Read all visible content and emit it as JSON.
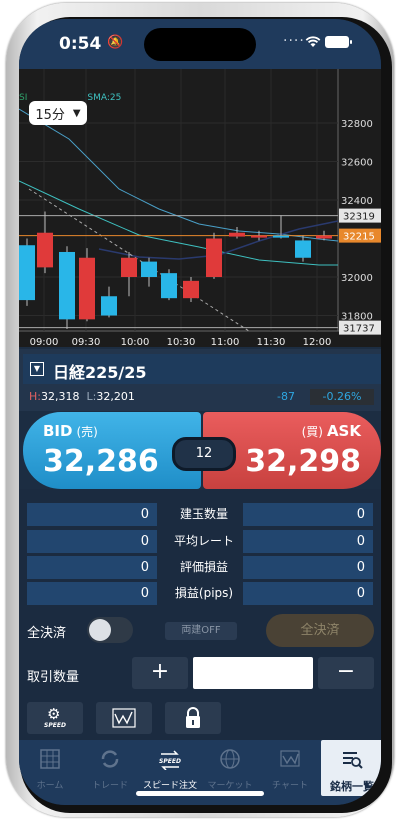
{
  "status": {
    "time": "0:54"
  },
  "chart": {
    "timeframe": "15分",
    "sma_label": "SMA:25",
    "y_ticks": [
      "32800",
      "32600",
      "32400",
      "32000",
      "31800"
    ],
    "x_ticks": [
      "09:00",
      "09:30",
      "10:00",
      "10:30",
      "11:00",
      "11:30",
      "12:00"
    ],
    "markers": {
      "high": "32319",
      "current": "32215",
      "low": "31737"
    },
    "colors": {
      "up": "#e03a3a",
      "down": "#29b6e8",
      "current": "#e8882c",
      "sma": "#3ec0c0"
    }
  },
  "symbol": {
    "name": "日経225/25",
    "high_label": "H:",
    "high": "32,318",
    "low_label": "L:",
    "low": "32,201",
    "change": "-87",
    "change_pct": "-0.26%"
  },
  "bid": {
    "label": "BID",
    "sub": "(売)",
    "value": "32,286"
  },
  "ask": {
    "label": "ASK",
    "sub": "(買)",
    "value": "32,298"
  },
  "spread": "12",
  "position": {
    "rows": [
      {
        "label": "建玉数量",
        "left": "0",
        "right": "0"
      },
      {
        "label": "平均レート",
        "left": "0",
        "right": "0"
      },
      {
        "label": "評価損益",
        "left": "0",
        "right": "0"
      },
      {
        "label": "損益(pips)",
        "left": "0",
        "right": "0"
      }
    ]
  },
  "controls": {
    "close_all_label": "全決済",
    "hedge_off": "両建OFF",
    "close_all_button": "全決済",
    "quantity_label": "取引数量",
    "plus": "+",
    "minus": "−",
    "speed_icon_text": "SPEED"
  },
  "tabs": [
    {
      "label": "ホーム",
      "icon": "home-icon"
    },
    {
      "label": "トレード",
      "icon": "trade-icon"
    },
    {
      "label": "スピード注文",
      "icon": "speed-order-icon"
    },
    {
      "label": "マーケット",
      "icon": "globe-icon"
    },
    {
      "label": "チャート",
      "icon": "chart-icon"
    },
    {
      "label": "銘柄一覧",
      "icon": "symbol-list-icon"
    }
  ]
}
